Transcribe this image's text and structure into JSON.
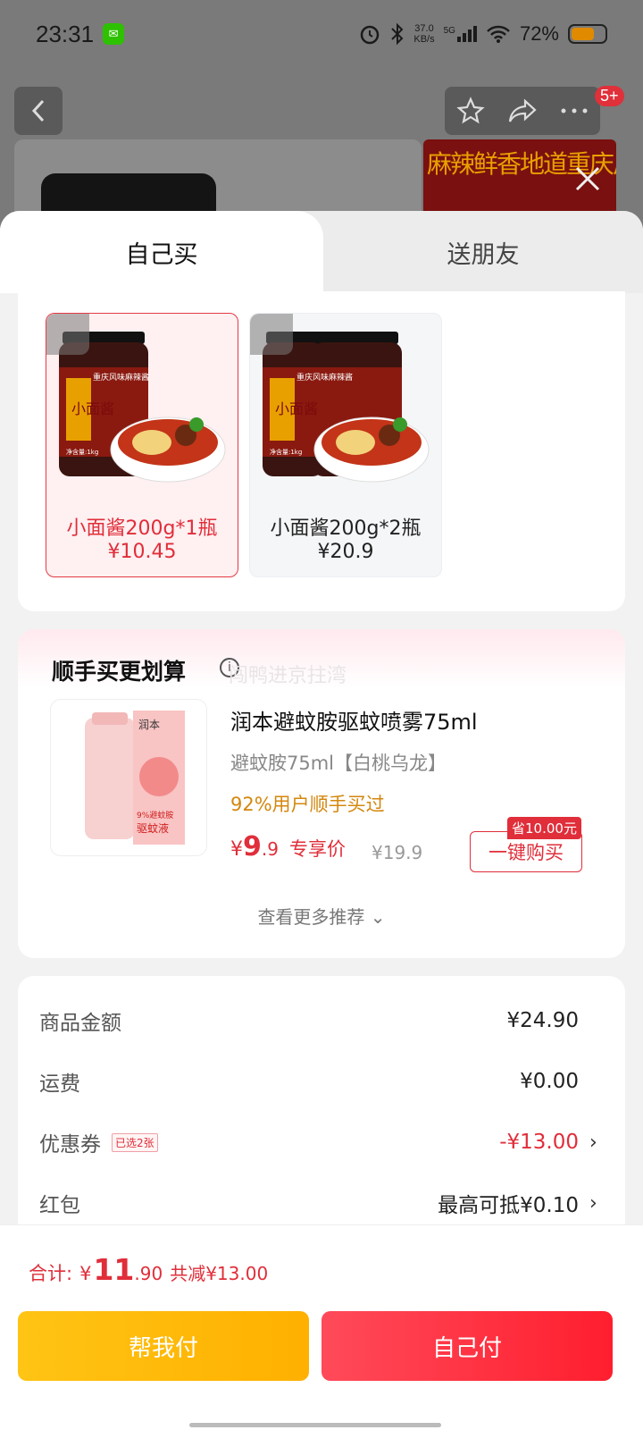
{
  "status_bar": {
    "time": "23:31",
    "net_speed_value": "37.0",
    "net_speed_unit": "KB/s",
    "signal": "5G",
    "battery": "72%"
  },
  "header": {
    "message_badge": "5+",
    "promo_text": "麻辣鲜香地道重庆风味"
  },
  "tabs": [
    {
      "label": "自己买",
      "active": true
    },
    {
      "label": "送朋友",
      "active": false
    }
  ],
  "specs": [
    {
      "label_line1": "小面酱200g*1瓶",
      "price": "¥10.45",
      "selected": true,
      "jar_label": "小面酱",
      "jar_banner": "重庆风味麻辣酱",
      "weight": "净含量:1kg"
    },
    {
      "label_line1": "小面酱200g*2瓶",
      "price": "¥20.9",
      "selected": false,
      "jar_label": "小面酱",
      "jar_banner": "重庆风味麻辣酱",
      "weight": "净含量:1kg"
    }
  ],
  "addon": {
    "title": "顺手买更划算",
    "info_icon": "i",
    "watermark": "闯鸭进京拄湾",
    "product_name": "润本避蚊胺驱蚊喷雾75ml",
    "spec": "避蚊胺75ml【白桃乌龙】",
    "stat": "92%用户顺手买过",
    "price_symbol": "¥",
    "price_int": "9",
    "price_dec": ".9",
    "price_tag": "专享价",
    "original_price": "¥19.9",
    "save_badge": "省10.00元",
    "buy_button": "一键购买",
    "more": "查看更多推荐",
    "more_icon": "⌄",
    "img_brand": "润本",
    "img_text1": "9%避蚊胺",
    "img_text2": "驱蚊液"
  },
  "summary": {
    "rows": [
      {
        "label": "商品金额",
        "value": "¥24.90"
      },
      {
        "label": "运费",
        "value": "¥0.00"
      },
      {
        "label": "优惠券",
        "tag": "已选2张",
        "value": "-¥13.00",
        "chevron": "›"
      },
      {
        "label": "红包",
        "value": "最高可抵¥0.10",
        "chevron": "›"
      }
    ]
  },
  "bottom": {
    "total_label": "合计:",
    "total_symbol": "¥",
    "total_int": "11",
    "total_dec": ".90",
    "reduce": "共减¥13.00",
    "help_pay": "帮我付",
    "self_pay": "自己付"
  },
  "colors": {
    "accent_red": "#e02e3a",
    "help_pay_yellow": "#ffb800",
    "self_pay_red": "#ff2f40",
    "addon_stat_orange": "#d4870e"
  },
  "icons": [
    "wechat-icon",
    "alarm-icon",
    "bluetooth-icon",
    "signal-icon",
    "wifi-icon",
    "battery-icon",
    "back-icon",
    "star-icon",
    "share-icon",
    "more-icon",
    "close-icon",
    "info-icon",
    "chevron-down-icon",
    "chevron-right-icon"
  ]
}
